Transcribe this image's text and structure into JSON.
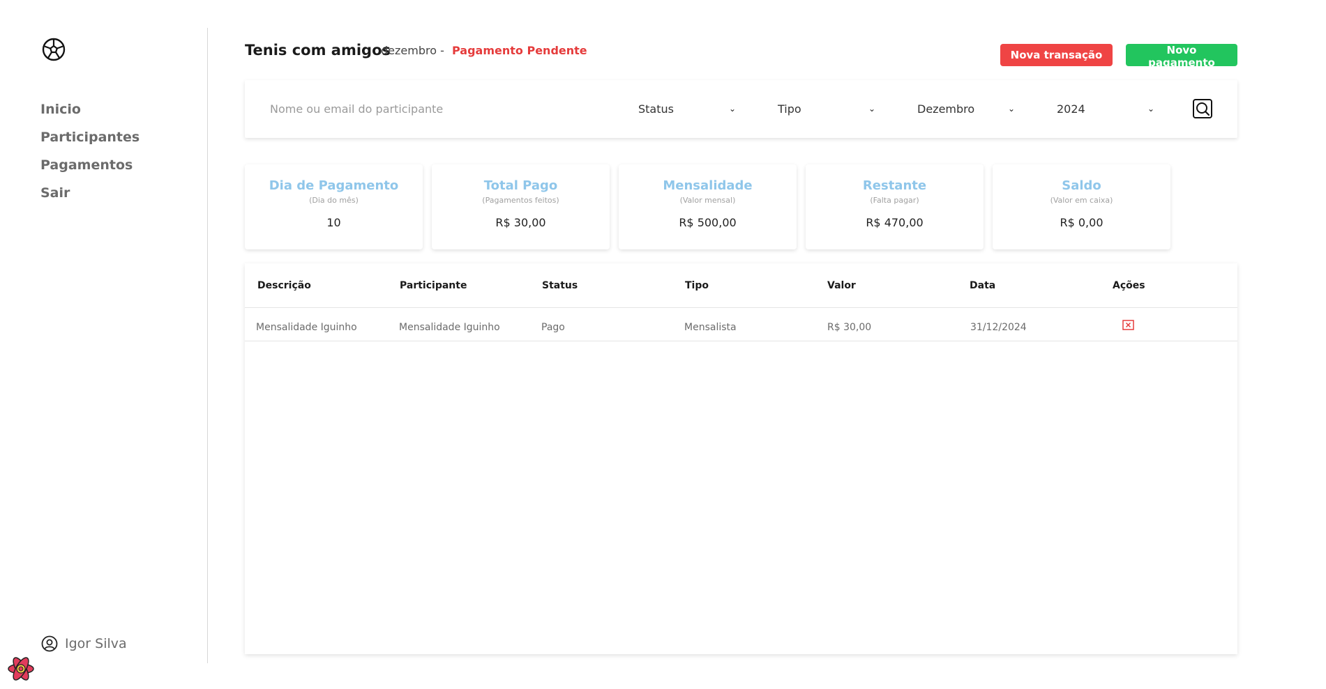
{
  "sidebar": {
    "items": [
      {
        "label": "Inicio"
      },
      {
        "label": "Participantes"
      },
      {
        "label": "Pagamentos"
      },
      {
        "label": "Sair"
      }
    ],
    "user_name": "Igor Silva"
  },
  "header": {
    "title": "Tenis com amigos",
    "month": "dezembro -",
    "status": "Pagamento Pendente",
    "btn_new_transaction": "Nova transação",
    "btn_new_payment": "Novo pagamento"
  },
  "filters": {
    "search_placeholder": "Nome ou email do participante",
    "status": "Status",
    "tipo": "Tipo",
    "month": "Dezembro",
    "year": "2024"
  },
  "cards": [
    {
      "title": "Dia de Pagamento",
      "sub": "(Dia do mês)",
      "value": "10"
    },
    {
      "title": "Total Pago",
      "sub": "(Pagamentos feitos)",
      "value": "R$ 30,00"
    },
    {
      "title": "Mensalidade",
      "sub": "(Valor mensal)",
      "value": "R$ 500,00"
    },
    {
      "title": "Restante",
      "sub": "(Falta pagar)",
      "value": "R$ 470,00"
    },
    {
      "title": "Saldo",
      "sub": "(Valor em caixa)",
      "value": "R$ 0,00"
    }
  ],
  "table": {
    "headers": [
      "Descrição",
      "Participante",
      "Status",
      "Tipo",
      "Valor",
      "Data",
      "Ações"
    ],
    "rows": [
      [
        "Mensalidade Iguinho",
        "Mensalidade Iguinho",
        "Pago",
        "Mensalista",
        "R$ 30,00",
        "31/12/2024"
      ]
    ]
  },
  "colors": {
    "accent_red": "#ef4444",
    "accent_green": "#22c55e",
    "card_title": "#8fc6ea"
  },
  "icons": {
    "logo": "soccer-ball-icon",
    "user": "user-circle-icon",
    "search": "search-icon",
    "delete": "close-box-icon",
    "chevron": "chevron-down-icon"
  }
}
